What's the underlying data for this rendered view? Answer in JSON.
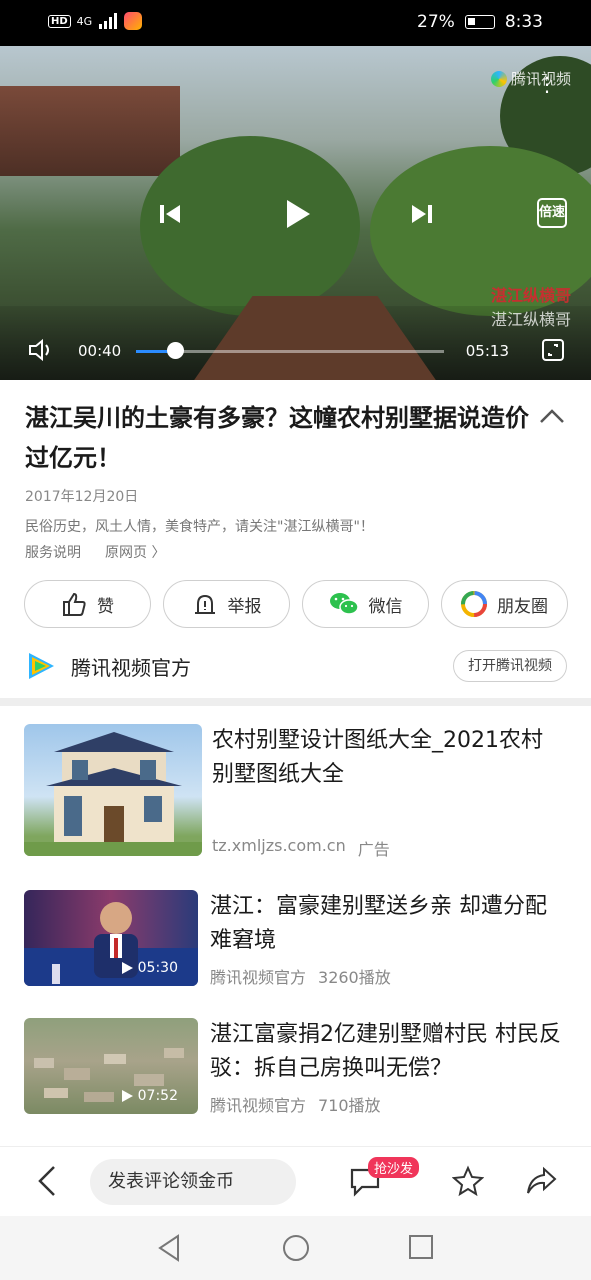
{
  "status_bar": {
    "hd": "HD",
    "network": "4G",
    "battery": "27%",
    "time": "8:33"
  },
  "video": {
    "watermark": "腾讯视频",
    "corner_watermark_red": "湛江纵横哥",
    "corner_watermark": "湛江纵横哥",
    "speed_label": "倍速",
    "current_time": "00:40",
    "duration": "05:13",
    "progress": 0.128
  },
  "article": {
    "title": "湛江吴川的土豪有多豪？这幢农村别墅据说造价过亿元！",
    "date": "2017年12月20日",
    "description": "民俗历史，风土人情，美食特产，请关注\"湛江纵横哥\"！",
    "service_label": "服务说明",
    "source_label": "原网页 〉"
  },
  "actions": [
    {
      "label": "赞",
      "icon": "thumbs-up-icon"
    },
    {
      "label": "举报",
      "icon": "report-icon"
    },
    {
      "label": "微信",
      "icon": "wechat-icon"
    },
    {
      "label": "朋友圈",
      "icon": "moments-icon"
    }
  ],
  "publisher": {
    "name": "腾讯视频官方",
    "open_label": "打开腾讯视频"
  },
  "feed": [
    {
      "title": "农村别墅设计图纸大全_2021农村别墅图纸大全",
      "source": "tz.xmljzs.com.cn",
      "tag": "广告"
    },
    {
      "title": "湛江：富豪建别墅送乡亲 却遭分配难窘境",
      "source": "腾讯视频官方",
      "plays": "3260播放",
      "duration": "05:30"
    },
    {
      "title": "湛江富豪捐2亿建别墅赠村民 村民反驳：拆自己房换叫无偿？",
      "source": "腾讯视频官方",
      "plays": "710播放",
      "duration": "07:52"
    }
  ],
  "bottom_bar": {
    "comment_placeholder": "发表评论领金币",
    "badge": "抢沙发"
  },
  "colors": {
    "accent": "#2b8cff",
    "badge": "#f0355a"
  }
}
